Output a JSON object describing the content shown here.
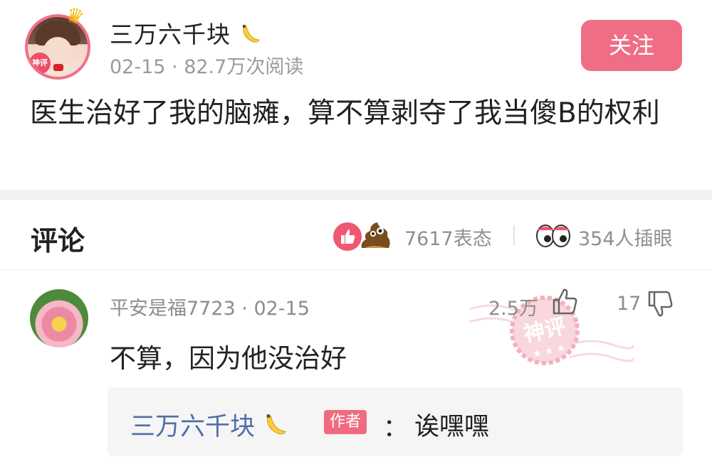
{
  "post": {
    "author": "三万六千块",
    "author_badge": "神评",
    "meta": "02-15 · 82.7万次阅读",
    "follow_label": "关注",
    "text": "医生治好了我的脑瘫，算不算剥夺了我当傻B的权利"
  },
  "comments_header": {
    "title": "评论",
    "reactions": "7617表态",
    "plugin": "354人插眼"
  },
  "comment": {
    "user": "平安是福7723 · 02-15",
    "likes": "2.5万",
    "dislikes": "17",
    "text": "不算，因为他没治好",
    "stamp_text": "神评",
    "reply": {
      "author": "三万六千块",
      "tag": "作者",
      "colon": "：",
      "text": "诶嘿嘿"
    }
  },
  "colors": {
    "accent": "#ef6e86",
    "link_blue": "#4f6fa8",
    "meta_gray": "#9a9a9a"
  },
  "icons": [
    "crown-icon",
    "banana-icon",
    "thumbs-up-reaction-icon",
    "poop-reaction-icon",
    "eyes-icon",
    "thumb-up-icon",
    "thumb-down-icon"
  ]
}
